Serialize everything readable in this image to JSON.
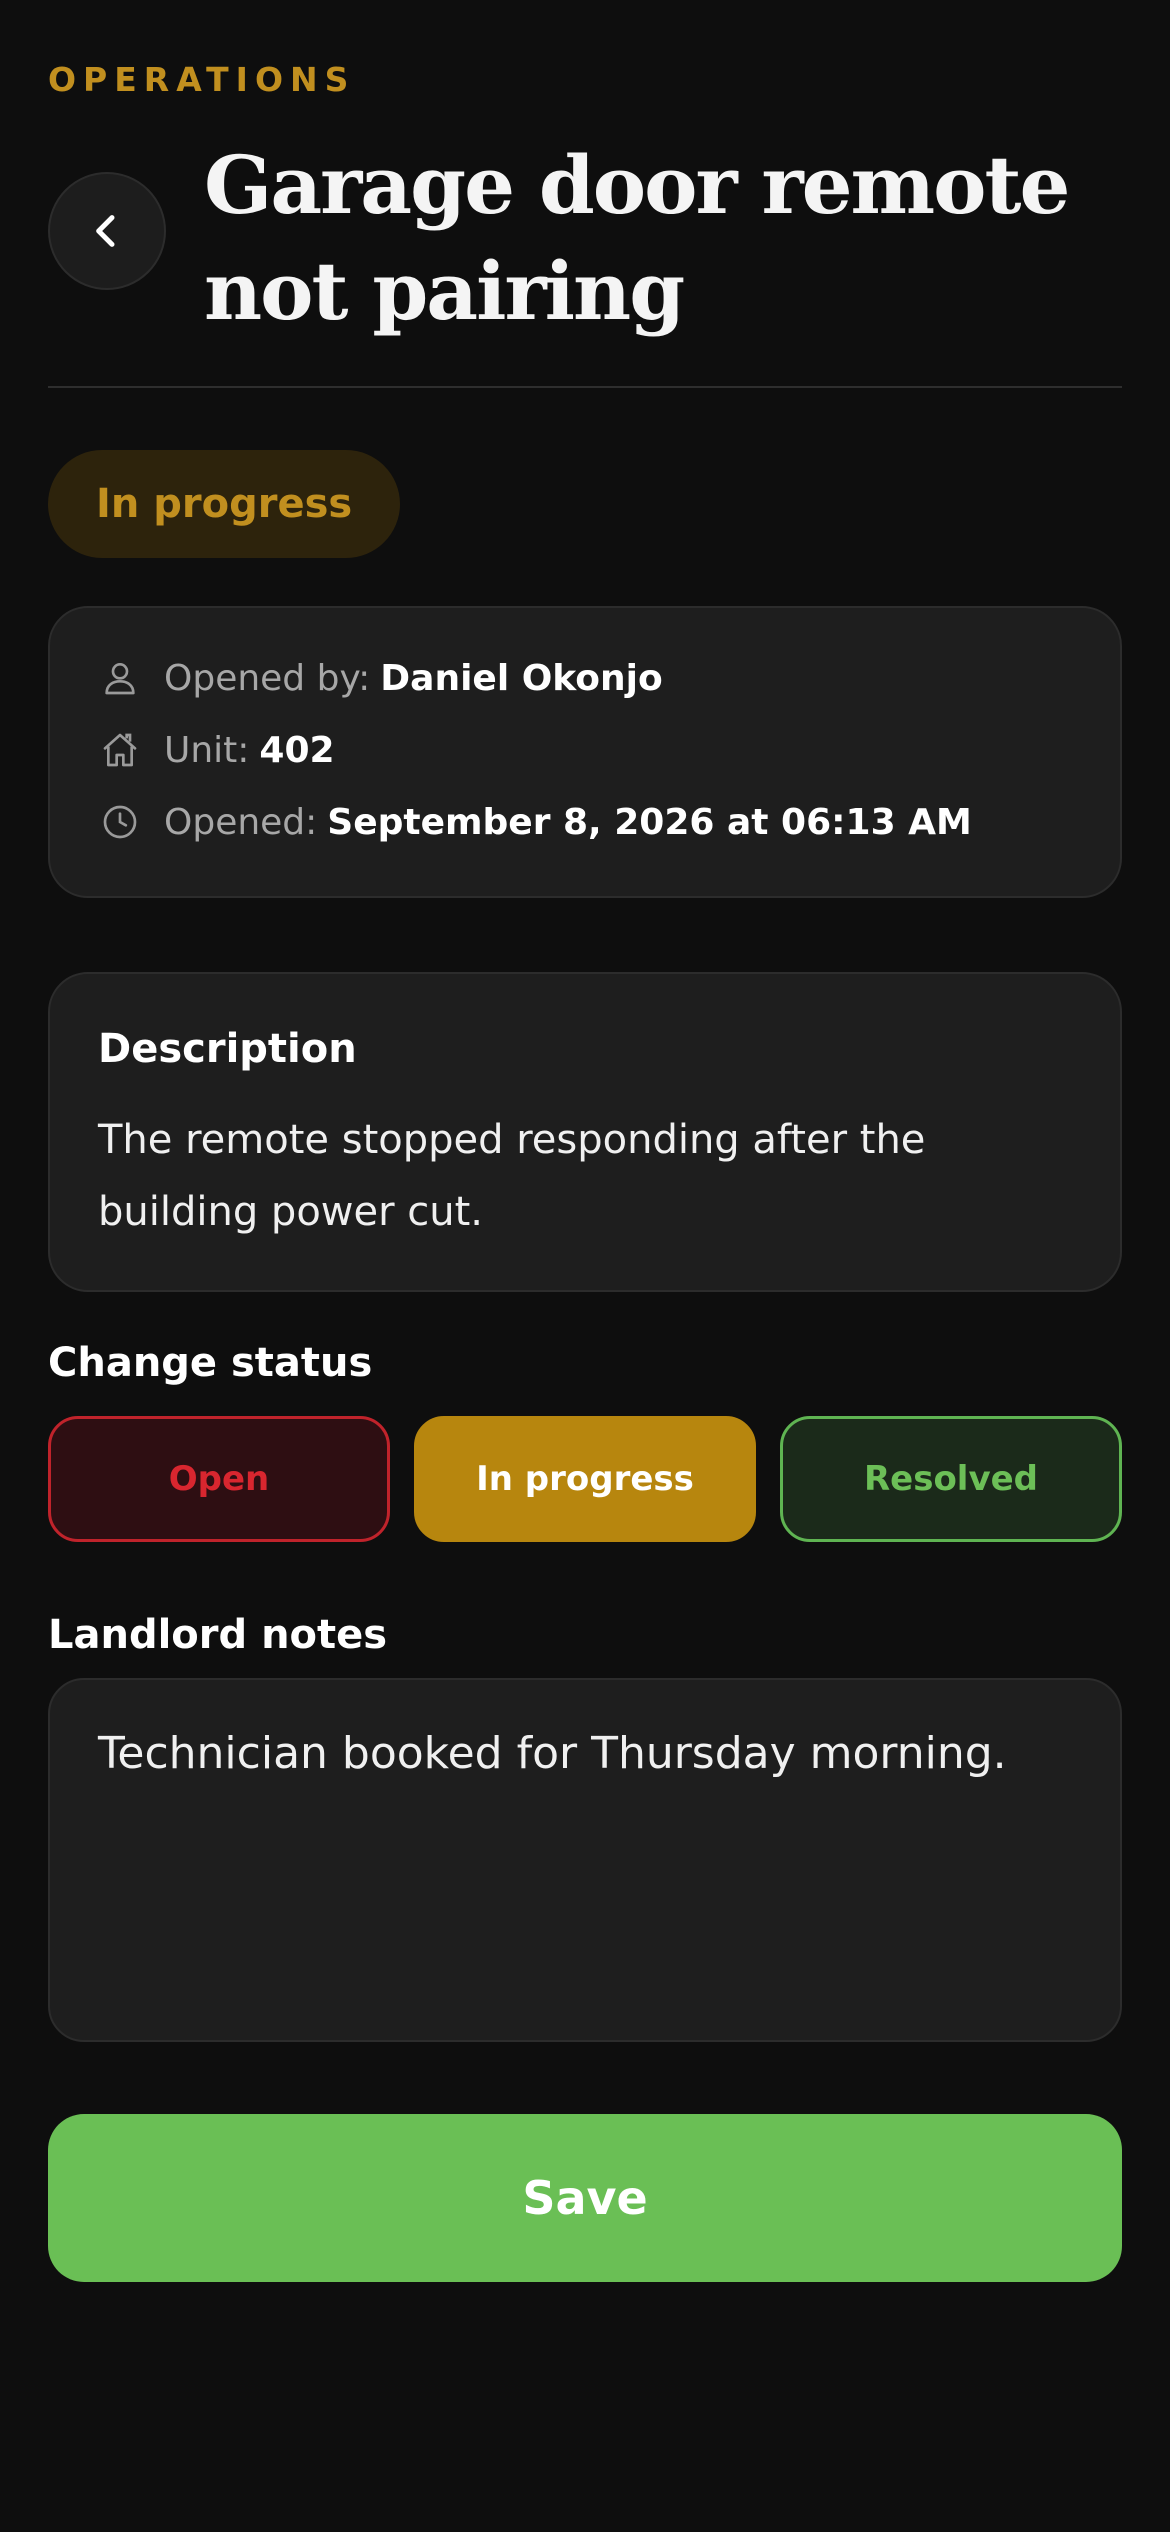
{
  "header": {
    "eyebrow": "OPERATIONS",
    "title": "Garage door remote not pairing",
    "back_icon": "chevron-left-icon"
  },
  "ticket": {
    "status": "In progress",
    "status_color": "#c18f1f",
    "meta": [
      {
        "icon": "user-icon",
        "label": "Opened by:",
        "value": "Daniel Okonjo"
      },
      {
        "icon": "home-icon",
        "label": "Unit:",
        "value": "402"
      },
      {
        "icon": "clock-icon",
        "label": "Opened:",
        "value": "September 8, 2026 at 06:13 AM"
      }
    ]
  },
  "description": {
    "heading": "Description",
    "text": "The remote stopped responding after the building power cut."
  },
  "change_status": {
    "label": "Change status",
    "options": [
      {
        "label": "Open",
        "color": "#d8262f"
      },
      {
        "label": "In progress",
        "color": "#b7860e",
        "selected": true
      },
      {
        "label": "Resolved",
        "color": "#6cbf57"
      }
    ]
  },
  "notes": {
    "label": "Landlord notes",
    "value": "Technician booked for Thursday morning."
  },
  "actions": {
    "save_label": "Save",
    "save_color": "#6abf55"
  }
}
